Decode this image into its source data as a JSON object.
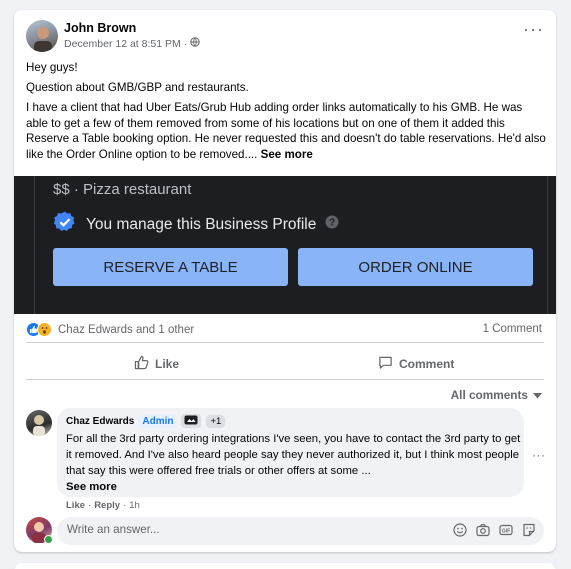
{
  "post": {
    "author": "John Brown",
    "timestamp": "December 12 at 8:51 PM",
    "separator": "·",
    "audience_icon": "globe-icon",
    "menu_icon": "more-horizontal-icon",
    "lines": [
      "Hey guys!",
      "Question about GMB/GBP and restaurants.",
      "I have a client that had Uber Eats/Grub Hub adding order links automatically to his GMB. He was able to get a few of them removed from some of his locations but on one of them it added this Reserve a Table booking option. He never requested this and doesn't do table reservations. He'd also like the Order Online option to be removed...."
    ],
    "see_more": "See more"
  },
  "media": {
    "price_category": "$$ · Pizza restaurant",
    "manage_text": "You manage this Business Profile",
    "reserve_button": "RESERVE A TABLE",
    "order_button": "ORDER ONLINE",
    "accent": "#8ab4f8"
  },
  "reactions": {
    "text": "Chaz Edwards and 1 other",
    "icons": [
      "like-reaction-icon",
      "wow-reaction-icon"
    ],
    "comment_count": "1 Comment"
  },
  "actions": {
    "like": "Like",
    "comment": "Comment"
  },
  "comments_filter": "All comments",
  "comment": {
    "author": "Chaz Edwards",
    "role_badge": "Admin",
    "extra_badge": "+1",
    "text": "For all the 3rd party ordering integrations I've seen, you have to contact the 3rd party to get it removed. And I've also heard people say they never authorized it, but I think most people that say this were offered free trials or other offers at some ...",
    "see_more": "See more",
    "like": "Like",
    "reply": "Reply",
    "dot": "·",
    "time": "1h",
    "menu": "···"
  },
  "composer": {
    "placeholder": "Write an answer...",
    "icons": [
      "emoji-icon",
      "camera-icon",
      "gif-icon",
      "sticker-icon"
    ]
  },
  "colors": {
    "brand_blue": "#1877f2",
    "secondary_text": "#65676b",
    "online_green": "#31a24c"
  }
}
